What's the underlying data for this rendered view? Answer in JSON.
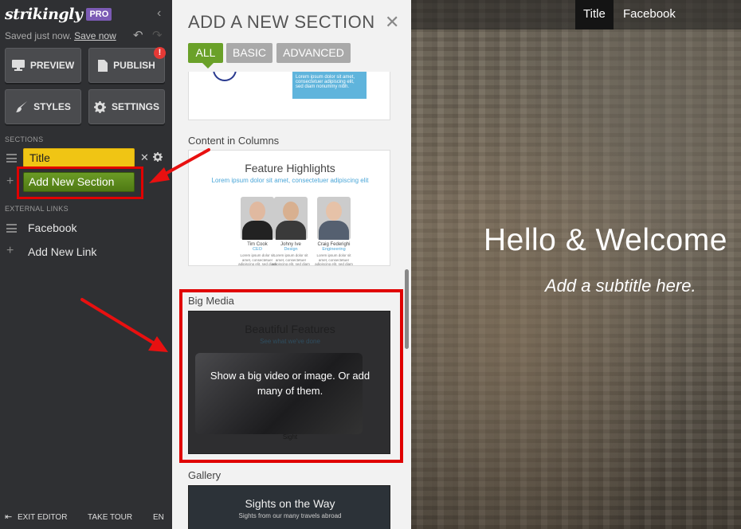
{
  "app": {
    "logo": "strikingly",
    "badge": "PRO"
  },
  "status": {
    "saved_text": "Saved just now.",
    "save_link": "Save now"
  },
  "toolbar": {
    "preview": "PREVIEW",
    "publish": "PUBLISH",
    "publish_alert": "!",
    "styles": "STYLES",
    "settings": "SETTINGS"
  },
  "sidebar": {
    "sections_heading": "SECTIONS",
    "sections": [
      {
        "label": "Title"
      }
    ],
    "add_section": "Add New Section",
    "external_heading": "EXTERNAL LINKS",
    "links": [
      {
        "label": "Facebook"
      }
    ],
    "add_link": "Add New Link"
  },
  "footer": {
    "exit": "EXIT EDITOR",
    "tour": "TAKE TOUR",
    "lang": "EN"
  },
  "panel": {
    "title": "ADD A NEW SECTION",
    "tabs": [
      {
        "label": "ALL",
        "active": true
      },
      {
        "label": "BASIC"
      },
      {
        "label": "ADVANCED"
      }
    ],
    "top_card_text": "Lorem ipsum dolor sit amet, consectetuer adipiscing elit, sed diam nonummy nibh.",
    "categories": [
      {
        "label": "Content in Columns",
        "preview_title": "Feature Highlights",
        "preview_subtitle": "Lorem ipsum dolor sit amet, consectetuer adipiscing elit",
        "people": [
          {
            "name": "Tim Cook",
            "role": "CEO",
            "desc": "Lorem ipsum dolor sit amet, consectetuer adipiscing elit, sed diam nonummy nibh."
          },
          {
            "name": "Johny Ive",
            "role": "Design",
            "desc": "Lorem ipsum dolor sit amet, consectetuer adipiscing elit, sed diam nonummy nibh."
          },
          {
            "name": "Craig Federighi",
            "role": "Engineering",
            "desc": "Lorem ipsum dolor sit amet, consectetuer adipiscing elit, sed diam nonummy nibh."
          }
        ]
      },
      {
        "label": "Big Media",
        "preview_title": "Beautiful Features",
        "preview_subtitle": "See what we've done",
        "preview_caption": "Sight",
        "description": "Show a big video or image. Or add many of them."
      },
      {
        "label": "Gallery",
        "preview_title": "Sights on the Way",
        "preview_subtitle": "Sights from our many travels abroad"
      }
    ]
  },
  "preview": {
    "nav": [
      {
        "label": "Title"
      },
      {
        "label": "Facebook"
      }
    ],
    "hero_title": "Hello & Welcome",
    "hero_subtitle": "Add a subtitle here."
  },
  "colors": {
    "sidebar_bg": "#2f3033",
    "accent_green": "#6aa129",
    "section_yellow": "#f0c514",
    "highlight_red": "#e00000",
    "pro_purple": "#7c5bb5"
  },
  "icons": [
    "collapse-chevron-icon",
    "undo-icon",
    "redo-icon",
    "monitor-icon",
    "page-icon",
    "brush-icon",
    "gear-icon",
    "drag-handle-icon",
    "close-icon",
    "plus-icon",
    "exit-icon"
  ]
}
